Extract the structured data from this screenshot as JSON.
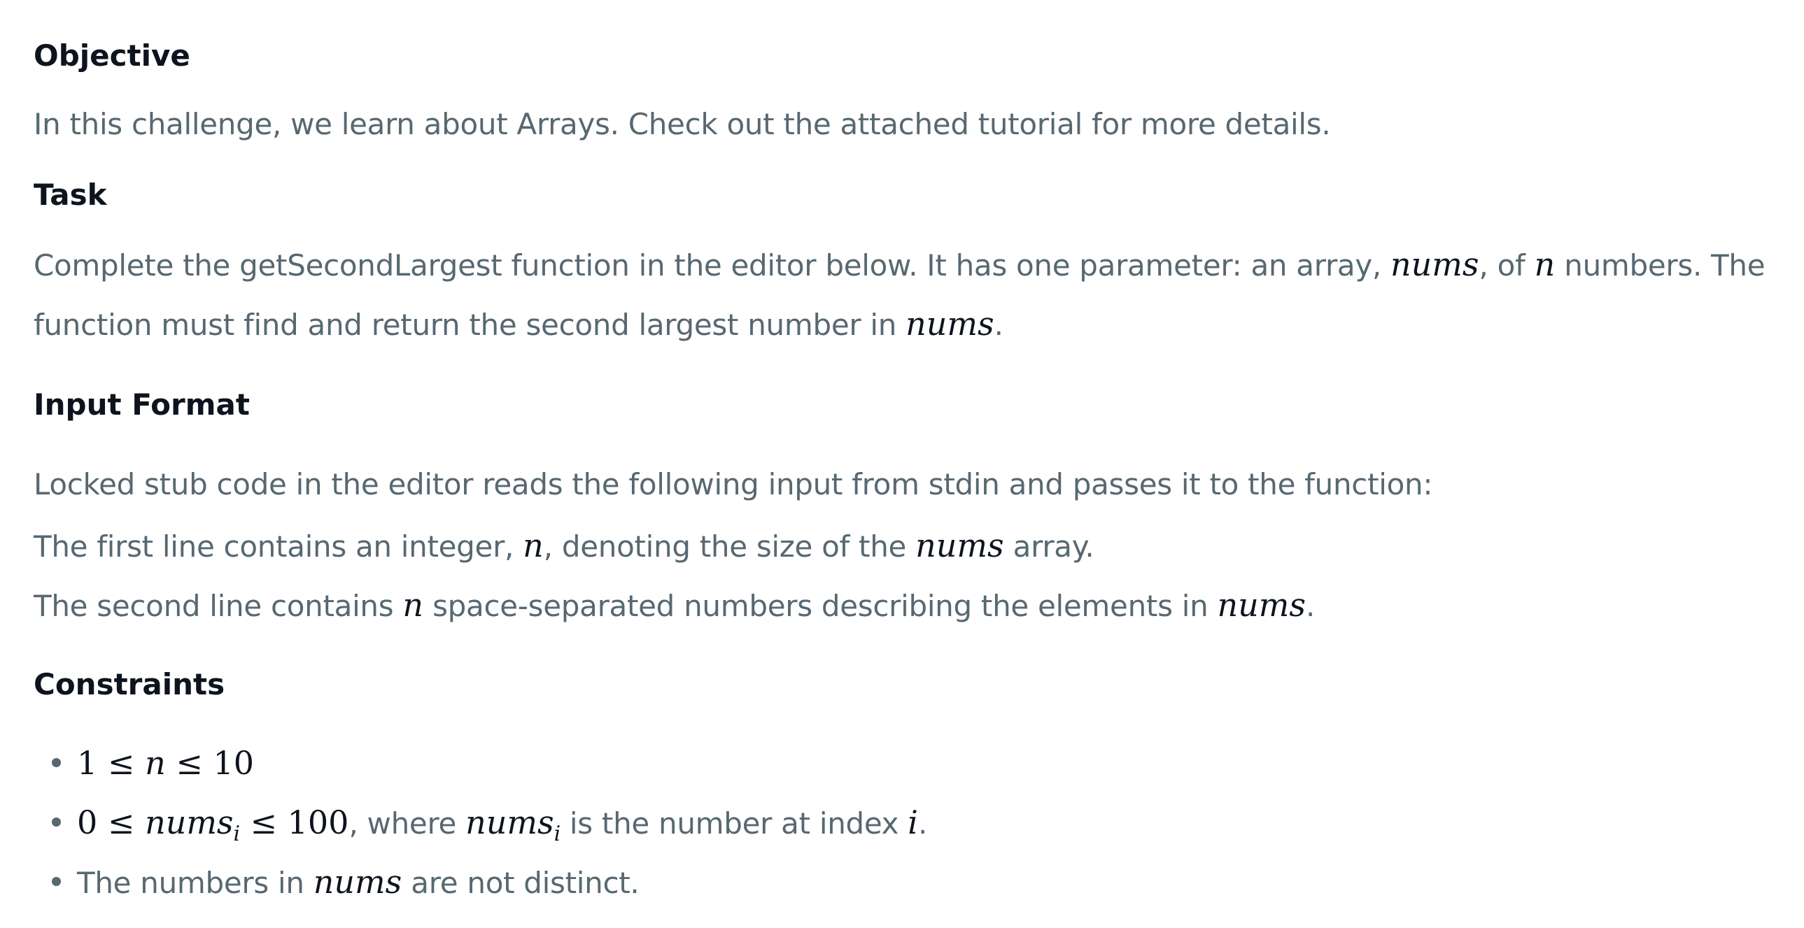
{
  "objective": {
    "heading": "Objective",
    "text": "In this challenge, we learn about Arrays. Check out the attached tutorial for more details."
  },
  "task": {
    "heading": "Task",
    "line1_a": "Complete the getSecondLargest function in the editor below. It has one parameter: an array, ",
    "var_nums": "nums",
    "line1_b": ", of ",
    "var_n": "n",
    "line1_c": " numbers. The",
    "line2_a": "function must find and return the second largest number in ",
    "line2_b": "."
  },
  "input_format": {
    "heading": "Input Format",
    "line1": "Locked stub code in the editor reads the following input from stdin and passes it to the function:",
    "line2_a": "The first line contains an integer, ",
    "line2_b": ", denoting the size of the ",
    "line2_c": " array.",
    "line3_a": "The second line contains ",
    "line3_b": " space-separated numbers describing the elements in ",
    "line3_c": "."
  },
  "constraints": {
    "heading": "Constraints",
    "c1_expr_a": "1 ≤ ",
    "c1_expr_n": "n",
    "c1_expr_b": " ≤ 10",
    "c2_expr_a": "0 ≤ ",
    "c2_expr_nums": "nums",
    "c2_expr_i": "i",
    "c2_expr_b": " ≤ 100",
    "c2_text_a": ", where ",
    "c2_text_b": " is the number at index ",
    "c2_text_c": ".",
    "c3_text_a": "The numbers in ",
    "c3_text_b": " are not distinct."
  }
}
